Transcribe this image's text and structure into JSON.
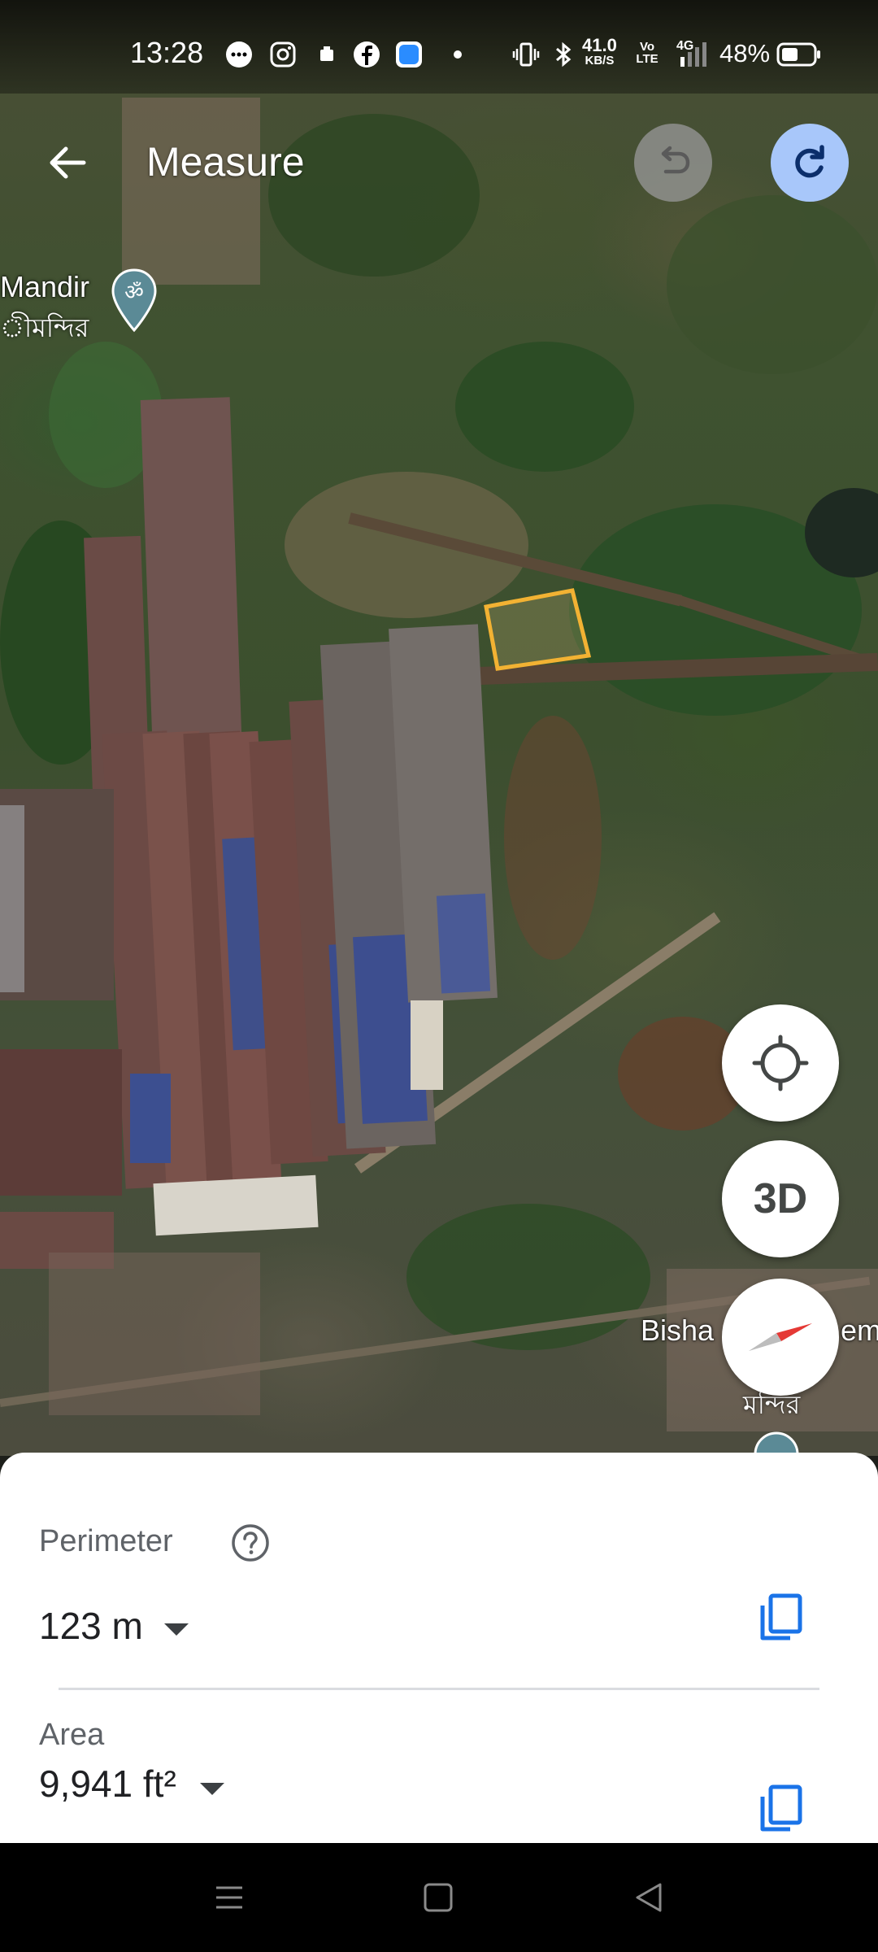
{
  "status_bar": {
    "time": "13:28",
    "net_speed_value": "41.0",
    "net_speed_unit": "KB/S",
    "volte": "Vo LTE",
    "network_type": "4G",
    "battery": "48%",
    "notification_icons": [
      "messages-icon",
      "instagram-icon",
      "app-icon",
      "facebook-icon",
      "app-icon",
      "dot-icon"
    ],
    "system_icons": [
      "vibrate-icon",
      "bluetooth-icon",
      "signal-icon",
      "battery-icon"
    ]
  },
  "top_bar": {
    "back_icon": "arrow-back-icon",
    "title": "Measure",
    "undo_icon": "undo-icon",
    "redo_icon": "redo-icon"
  },
  "map": {
    "labels": [
      {
        "text": "Mandir",
        "sub": "ীমন্দির",
        "icon": "om-place-icon"
      },
      {
        "text": "Bisha",
        "suffix": "emp",
        "sub1": "ि",
        "sub2": "মন্দির",
        "icon": "om-place-icon"
      }
    ],
    "measure_shape_color": "#f2b233"
  },
  "map_buttons": {
    "locate_icon": "my-location-icon",
    "three_d_label": "3D",
    "compass_icon": "compass-icon"
  },
  "measurements": {
    "perimeter_label": "Perimeter",
    "perimeter_value": "123 m",
    "help_icon": "help-circle-icon",
    "area_label": "Area",
    "area_value": "9,941 ft²",
    "copy_icon": "copy-icon",
    "accent_color": "#1a73e8"
  },
  "nav_bar": {
    "icons": [
      "menu-icon",
      "home-icon",
      "back-icon"
    ]
  }
}
